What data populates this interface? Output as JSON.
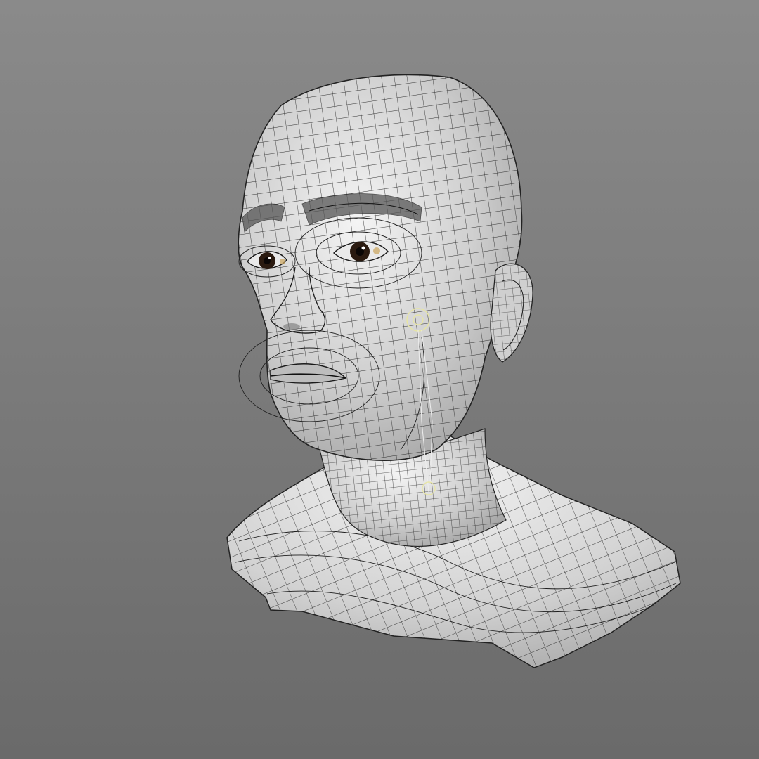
{
  "viewport": {
    "background_color": "#7f7f7f",
    "mesh_fill_color": "#d8d8d8",
    "wire_color": "#1e1e1e",
    "gizmo_color": "#e8e6a0",
    "eye_iris_color": "#2a1a10"
  },
  "model": {
    "subject": "head-bust-wireframe",
    "shading": "wireframe-on-shaded",
    "lighting": "soft"
  }
}
